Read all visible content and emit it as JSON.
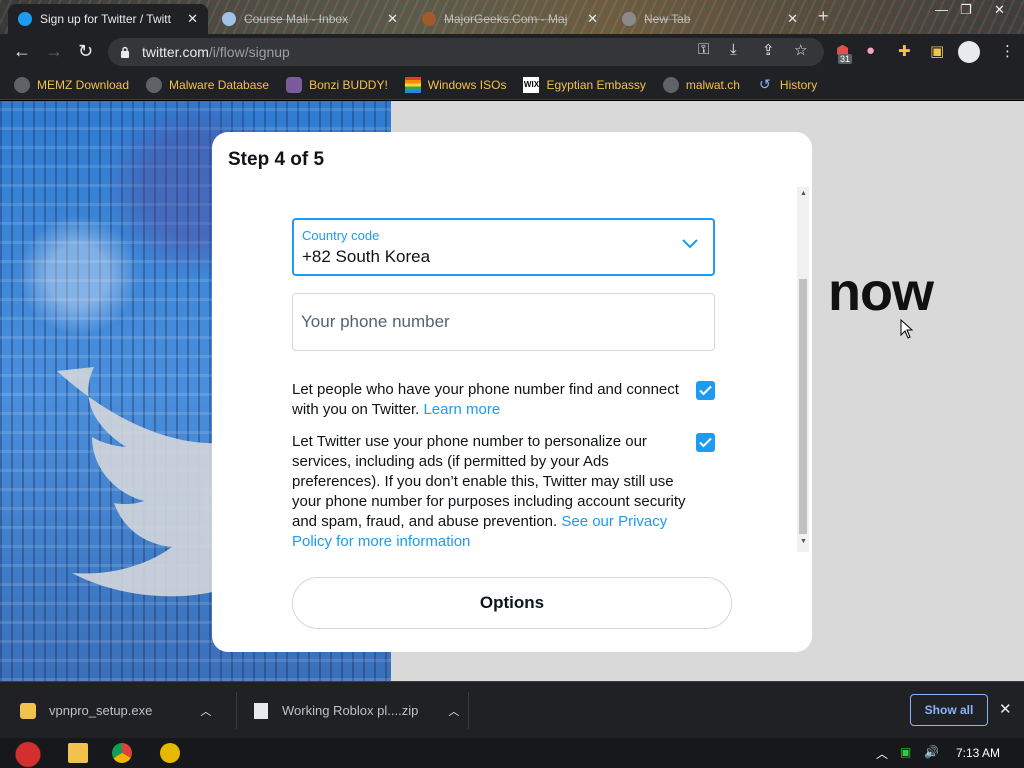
{
  "browser": {
    "tabs": [
      {
        "title": "Sign up for Twitter / Twitt",
        "active": true
      },
      {
        "title": "Course Mail - Inbox",
        "active": false
      },
      {
        "title": "MajorGeeks.Com - Maj",
        "active": false
      },
      {
        "title": "New Tab",
        "active": false
      }
    ],
    "url_host": "twitter.com",
    "url_path": "/i/flow/signup",
    "extension_badge": "31",
    "bookmarks": [
      {
        "label": "MEMZ Download",
        "icon": "globe-icon"
      },
      {
        "label": "Malware Database",
        "icon": "globe-icon"
      },
      {
        "label": "Bonzi BUDDY!",
        "icon": "bonzi-icon"
      },
      {
        "label": "Windows ISOs",
        "icon": "windows-flag-icon"
      },
      {
        "label": "Egyptian Embassy",
        "icon": "wix-icon"
      },
      {
        "label": "malwat.ch",
        "icon": "globe-icon"
      },
      {
        "label": "History",
        "icon": "history-icon"
      }
    ]
  },
  "background": {
    "headline_fragment": "now"
  },
  "modal": {
    "step": "Step 4 of 5",
    "country_label": "Country code",
    "country_value": "+82 South Korea",
    "phone_placeholder": "Your phone number",
    "pref1_text": "Let people who have your phone number find and connect with you on Twitter.",
    "pref1_link": "Learn more",
    "pref1_checked": true,
    "pref2_text": "Let Twitter use your phone number to personalize our services, including ads (if permitted by your Ads preferences). If you don’t enable this, Twitter may still use your phone number for purposes including account security and spam, fraud, and abuse prevention.",
    "pref2_link": "See our Privacy Policy for more information",
    "pref2_checked": true,
    "options_button": "Options"
  },
  "downloads": {
    "items": [
      {
        "name": "vpnpro_setup.exe"
      },
      {
        "name": "Working Roblox pl....zip"
      }
    ],
    "show_all": "Show all"
  },
  "taskbar": {
    "time": "7:13 AM"
  },
  "colors": {
    "accent": "#1d9bf0",
    "chrome_dark": "#202124",
    "bookmark_text": "#f2c14e"
  }
}
